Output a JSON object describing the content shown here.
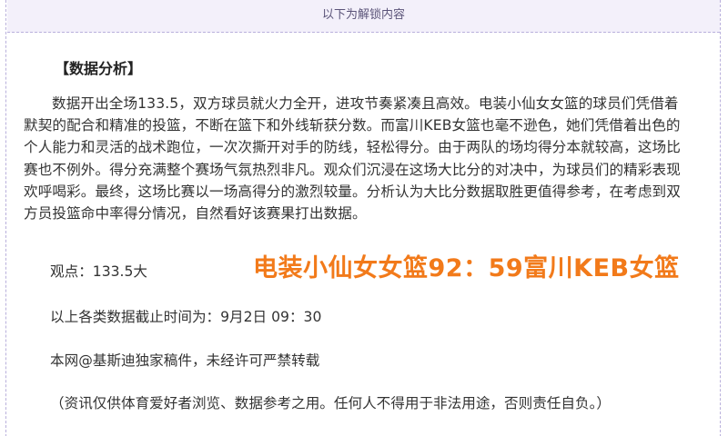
{
  "banner": {
    "text": "以下为解锁内容"
  },
  "article": {
    "heading": "【数据分析】",
    "paragraph_lines": [
      "数据开出全场133.5，双方球员就火力全开，进攻节奏紧凑且高效。电装小仙女女篮的球员们凭借着",
      "默契的配合和精准的投篮，不断在篮下和外线斩获分数。而富川KEB女篮也毫不逊色，她们凭借着出色的",
      "个人能力和灵活的战术跑位，一次次撕开对手的防线，轻松得分。由于两队的场均得分本就较高，这场比",
      "赛也不例外。得分充满整个赛场气氛热烈非凡。观众们沉浸在这场大比分的对决中，为球员们的精彩表现",
      "欢呼喝彩。最终，这场比赛以一场高得分的激烈较量。分析认为大比分数据取胜更值得参考，在考虑到双",
      "方员投篮命中率得分情况，自然看好该赛果打出数据。"
    ],
    "viewpoint": "观点：133.5大",
    "score_overlay": "电装小仙女女篮92：59富川KEB女篮",
    "deadline": "以上各类数据截止时间为：9月2日 09：30",
    "copyright": "本网@基斯迪独家稿件，未经许可严禁转载",
    "disclaimer": "（资讯仅供体育爱好者浏览、数据参考之用。任何人不得用于非法用途，否则责任自负。）"
  },
  "colors": {
    "score_overlay": "#f27a1a",
    "banner_bg": "#f3f0fa",
    "frame_border": "#b9b0dc"
  }
}
